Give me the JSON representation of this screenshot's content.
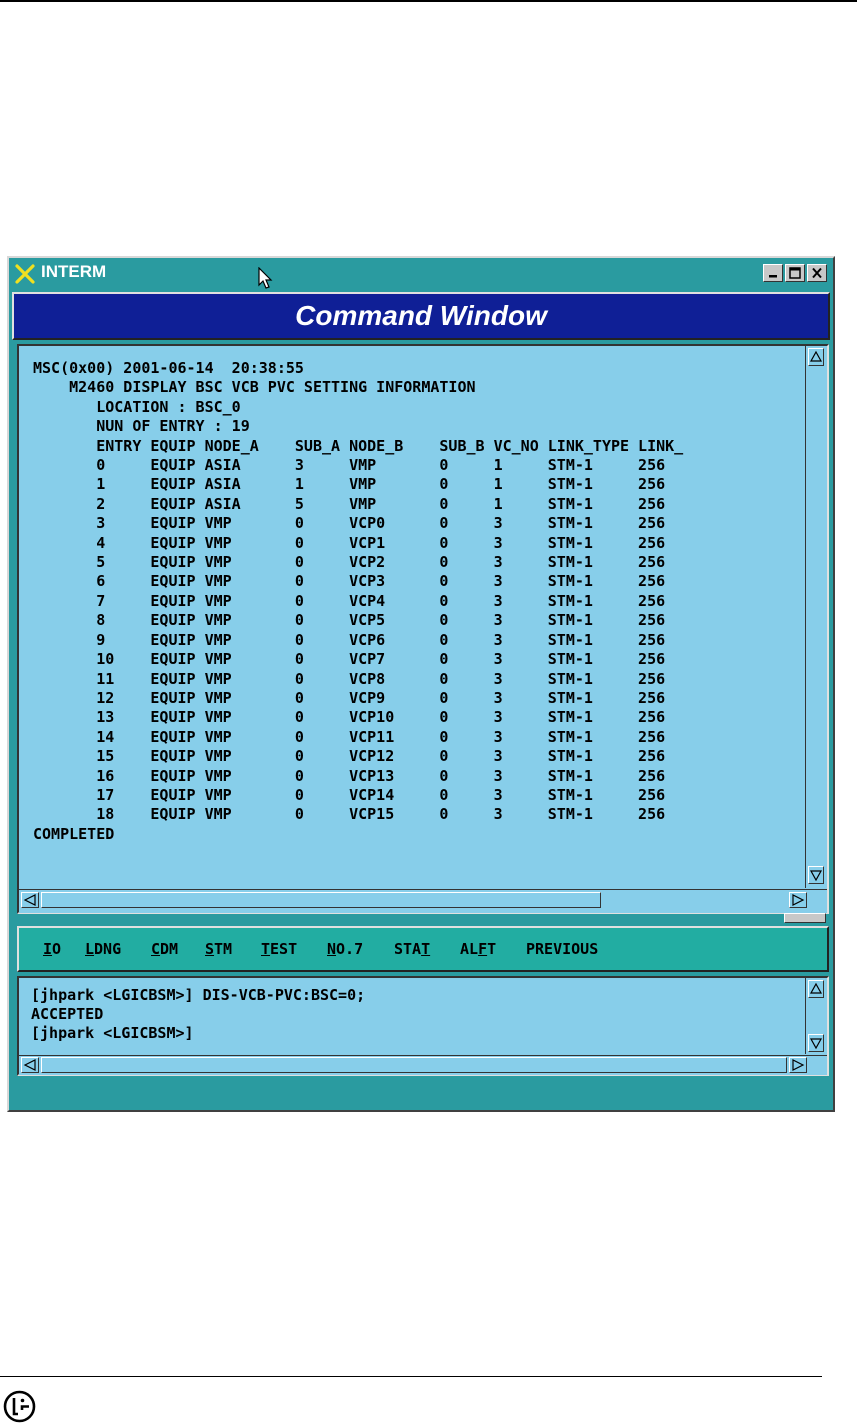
{
  "window": {
    "title": "INTERM",
    "header": "Command Window"
  },
  "output": {
    "lines": [
      "MSC(0x00) 2001-06-14  20:38:55",
      "    M2460 DISPLAY BSC VCB PVC SETTING INFORMATION",
      "       LOCATION : BSC_0",
      "       NUN OF ENTRY : 19",
      "       ENTRY EQUIP NODE_A    SUB_A NODE_B    SUB_B VC_NO LINK_TYPE LINK_",
      "       0     EQUIP ASIA      3     VMP       0     1     STM-1     256",
      "       1     EQUIP ASIA      1     VMP       0     1     STM-1     256",
      "       2     EQUIP ASIA      5     VMP       0     1     STM-1     256",
      "       3     EQUIP VMP       0     VCP0      0     3     STM-1     256",
      "       4     EQUIP VMP       0     VCP1      0     3     STM-1     256",
      "       5     EQUIP VMP       0     VCP2      0     3     STM-1     256",
      "       6     EQUIP VMP       0     VCP3      0     3     STM-1     256",
      "       7     EQUIP VMP       0     VCP4      0     3     STM-1     256",
      "       8     EQUIP VMP       0     VCP5      0     3     STM-1     256",
      "       9     EQUIP VMP       0     VCP6      0     3     STM-1     256",
      "       10    EQUIP VMP       0     VCP7      0     3     STM-1     256",
      "       11    EQUIP VMP       0     VCP8      0     3     STM-1     256",
      "       12    EQUIP VMP       0     VCP9      0     3     STM-1     256",
      "       13    EQUIP VMP       0     VCP10     0     3     STM-1     256",
      "       14    EQUIP VMP       0     VCP11     0     3     STM-1     256",
      "       15    EQUIP VMP       0     VCP12     0     3     STM-1     256",
      "       16    EQUIP VMP       0     VCP13     0     3     STM-1     256",
      "       17    EQUIP VMP       0     VCP14     0     3     STM-1     256",
      "       18    EQUIP VMP       0     VCP15     0     3     STM-1     256",
      "COMPLETED"
    ]
  },
  "menu": {
    "items": [
      {
        "pre": "",
        "ul": "I",
        "post": "O"
      },
      {
        "pre": "",
        "ul": "L",
        "post": "DNG"
      },
      {
        "pre": "",
        "ul": "C",
        "post": "DM"
      },
      {
        "pre": "",
        "ul": "S",
        "post": "TM"
      },
      {
        "pre": "",
        "ul": "T",
        "post": "EST"
      },
      {
        "pre": "",
        "ul": "N",
        "post": "O.7"
      },
      {
        "pre": "STA",
        "ul": "T",
        "post": ""
      },
      {
        "pre": "AL",
        "ul": "F",
        "post": "T"
      },
      {
        "pre": "PREVIOUS",
        "ul": "",
        "post": ""
      }
    ]
  },
  "input": {
    "lines": [
      "[jhpark <LGICBSM>] DIS-VCB-PVC:BSC=0;",
      "ACCEPTED",
      "[jhpark <LGICBSM>]"
    ]
  },
  "icons": {
    "title": "x-logo-icon",
    "minimize": "minimize-icon",
    "maximize": "maximize-icon",
    "close": "close-icon",
    "logo": "lg-logo-icon"
  },
  "colors": {
    "window_frame": "#2a9ba0",
    "header_bg": "#0f1f96",
    "pane_bg": "#87ceea",
    "menubar_bg": "#22ada2"
  }
}
